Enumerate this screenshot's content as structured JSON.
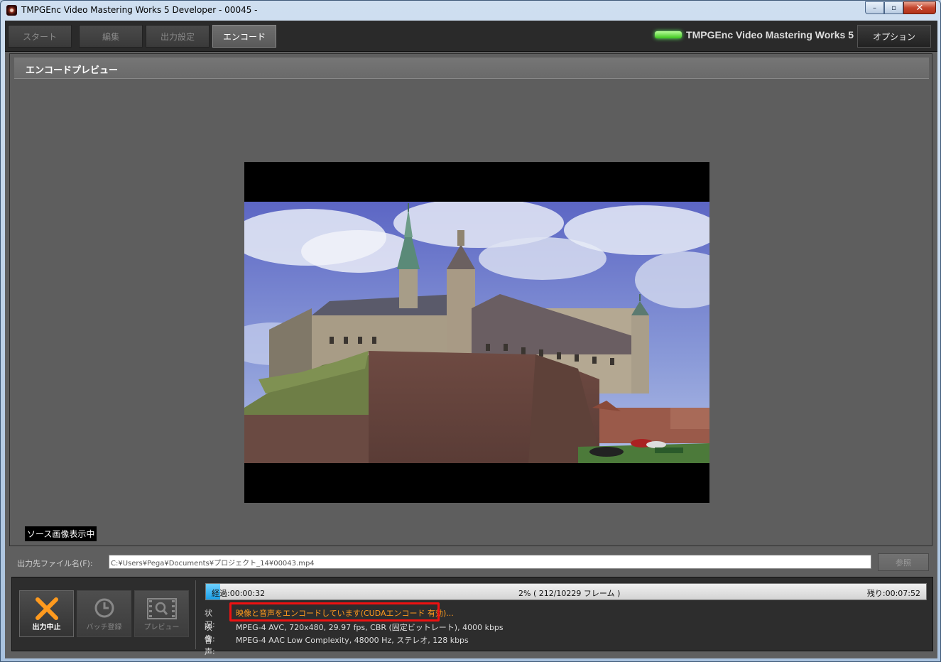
{
  "window": {
    "title": "TMPGEnc Video Mastering Works 5 Developer - 00045 -",
    "min_glyph": "–",
    "max_glyph": "▫",
    "close_glyph": "✕"
  },
  "tabs": [
    {
      "label": "スタート",
      "active": false
    },
    {
      "label": "編集",
      "active": false
    },
    {
      "label": "出力設定",
      "active": false
    },
    {
      "label": "エンコード",
      "active": true
    }
  ],
  "brand": "TMPGEnc Video Mastering Works 5",
  "options_label": "オプション",
  "panel_title": "エンコードプレビュー",
  "source_badge": "ソース画像表示中",
  "output": {
    "label": "出力先ファイル名(F):",
    "path": "C:¥Users¥Pega¥Documents¥プロジェクト_14¥00043.mp4",
    "browse_label": "参照"
  },
  "buttons": {
    "stop": "出力中止",
    "batch": "バッチ登録",
    "preview": "プレビュー"
  },
  "progress": {
    "fraction": 0.02,
    "elapsed": "経過:00:00:32",
    "center": "2% ( 212/10229 フレーム )",
    "remaining": "残り:00:07:52"
  },
  "info": {
    "status_key": "状況:",
    "status_value": "映像と音声をエンコードしています(CUDAエンコード 有効)...",
    "video_key": "映像:",
    "video_value": "MPEG-4 AVC, 720x480, 29.97 fps, CBR (固定ビットレート), 4000 kbps",
    "audio_key": "音声:",
    "audio_value": "MPEG-4 AAC Low Complexity, 48000 Hz, ステレオ, 128 kbps"
  },
  "colors": {
    "progress_fill": "#1aa0e8",
    "status_text": "#ff9a1e",
    "highlight_border": "#ee1111",
    "brand_led": "#3cc41c"
  }
}
